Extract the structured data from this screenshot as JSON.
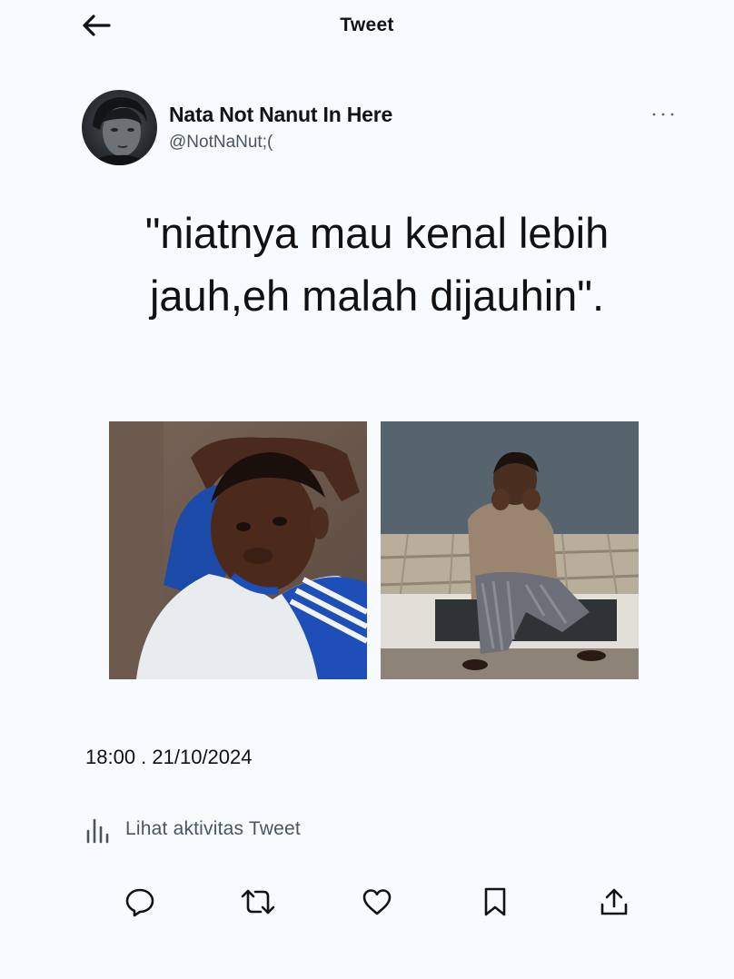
{
  "header": {
    "title": "Tweet",
    "back_icon": "arrow-left-icon"
  },
  "author": {
    "display_name": "Nata Not Nanut In Here",
    "handle": "@NotNaNut;("
  },
  "tweet": {
    "text": "\"niatnya mau kenal lebih jauh,eh malah dijauhin\".",
    "timestamp": "18:00 . 21/10/2024"
  },
  "activity": {
    "label": "Lihat aktivitas Tweet",
    "icon": "analytics-icon"
  },
  "actions": [
    {
      "name": "reply",
      "icon": "reply-icon"
    },
    {
      "name": "retweet",
      "icon": "retweet-icon"
    },
    {
      "name": "like",
      "icon": "heart-icon"
    },
    {
      "name": "bookmark",
      "icon": "bookmark-icon"
    },
    {
      "name": "share",
      "icon": "share-icon"
    }
  ],
  "colors": {
    "background": "#f7fbfd",
    "text": "#0f1419",
    "secondary_text": "#4a5560"
  }
}
